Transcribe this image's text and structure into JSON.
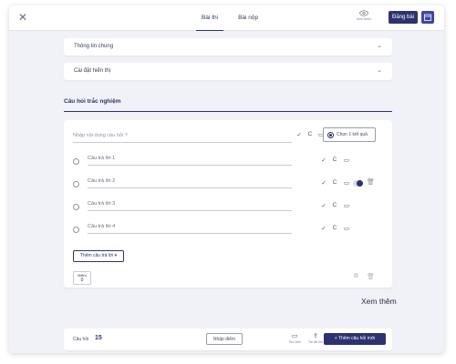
{
  "header": {
    "tabs": [
      {
        "label": "Bài thi",
        "active": true
      },
      {
        "label": "Bài nộp",
        "active": false
      }
    ],
    "preview_label": "Xem trước",
    "post_button": "Đăng bài"
  },
  "panels": [
    {
      "title": "Thông tin chung"
    },
    {
      "title": "Cài đặt hiển thị"
    }
  ],
  "section_title": "Câu hỏi trắc nghiệm",
  "question": {
    "placeholder": "Nhập nội dung câu hỏi ?",
    "choose_mode": "Chọn 1 kết quả",
    "answers": [
      {
        "placeholder": "Câu trả lời 1"
      },
      {
        "placeholder": "Câu trả lời 2"
      },
      {
        "placeholder": "Câu trả lời 3"
      },
      {
        "placeholder": "Câu trả lời 4"
      }
    ],
    "add_answer": "Thêm câu trả lời",
    "score_label": "Điểm",
    "score_value": "0"
  },
  "see_more": "Xem thêm",
  "footer": {
    "count_label": "Câu hỏi",
    "count_value": "15",
    "import_button": "Nhập điểm",
    "library_label": "Thư viện",
    "upload_label": "Tải file lên",
    "new_question_button": "Thêm câu hỏi mới"
  },
  "colors": {
    "accent": "#2e3270",
    "background": "#f1f2f7"
  }
}
